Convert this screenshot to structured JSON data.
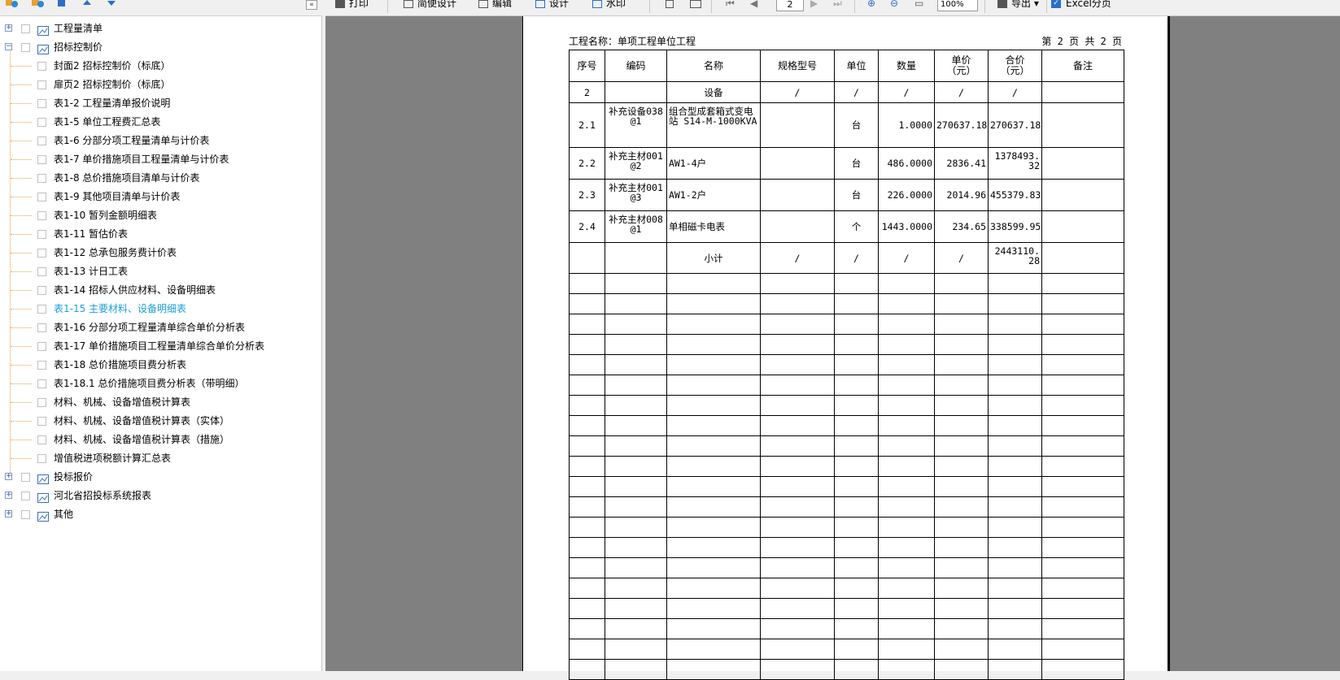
{
  "tree": {
    "nodes": [
      {
        "label": "工程量清单",
        "expander": "+"
      },
      {
        "label": "招标控制价",
        "expander": "−"
      },
      {
        "label": "封面2 招标控制价（标底）"
      },
      {
        "label": "扉页2 招标控制价（标底）"
      },
      {
        "label": "表1-2 工程量清单报价说明"
      },
      {
        "label": "表1-5 单位工程费汇总表"
      },
      {
        "label": "表1-6 分部分项工程量清单与计价表"
      },
      {
        "label": "表1-7 单价措施项目工程量清单与计价表"
      },
      {
        "label": "表1-8 总价措施项目清单与计价表"
      },
      {
        "label": "表1-9 其他项目清单与计价表"
      },
      {
        "label": "表1-10 暂列金额明细表"
      },
      {
        "label": "表1-11 暂估价表"
      },
      {
        "label": "表1-12 总承包服务费计价表"
      },
      {
        "label": "表1-13 计日工表"
      },
      {
        "label": "表1-14 招标人供应材料、设备明细表"
      },
      {
        "label": "表1-15 主要材料、设备明细表"
      },
      {
        "label": "表1-16 分部分项工程量清单综合单价分析表"
      },
      {
        "label": "表1-17 单价措施项目工程量清单综合单价分析表"
      },
      {
        "label": "表1-18 总价措施项目费分析表"
      },
      {
        "label": "表1-18.1 总价措施项目费分析表（带明细）"
      },
      {
        "label": "材料、机械、设备增值税计算表"
      },
      {
        "label": "材料、机械、设备增值税计算表（实体）"
      },
      {
        "label": "材料、机械、设备增值税计算表（措施）"
      },
      {
        "label": "增值税进项税额计算汇总表"
      },
      {
        "label": "投标报价",
        "expander": "+"
      },
      {
        "label": "河北省招投标系统报表",
        "expander": "+"
      },
      {
        "label": "其他",
        "expander": "+"
      }
    ],
    "selected_color": "#1aa0d8"
  },
  "toolbar": {
    "print": "打印",
    "quick_design": "简便设计",
    "edit": "编辑",
    "design": "设计",
    "watermark": "水印",
    "page": "2",
    "zoom": "100%",
    "export": "导出",
    "excel_split": "Excel分页"
  },
  "report": {
    "project": "工程名称：单项工程单位工程",
    "page_info": "第 2 页  共 2 页",
    "headers": [
      "序号",
      "编码",
      "名称",
      "规格型号",
      "单位",
      "数量",
      "单价\n（元）",
      "合价\n（元）",
      "备注"
    ],
    "rows": [
      [
        "2",
        "",
        "设备",
        "/",
        "/",
        "/",
        "/",
        "/",
        ""
      ],
      [
        "2.1",
        "补充设备038@1",
        "组合型成套箱式变电站 S14-M-1000KVA",
        "",
        "台",
        "1.0000",
        "270637.18",
        "270637.18",
        ""
      ],
      [
        "2.2",
        "补充主材001@2",
        "AW1-4户",
        "",
        "台",
        "486.0000",
        "2836.41",
        "1378493.32",
        ""
      ],
      [
        "2.3",
        "补充主材001@3",
        "AW1-2户",
        "",
        "台",
        "226.0000",
        "2014.96",
        "455379.83",
        ""
      ],
      [
        "2.4",
        "补充主材008@1",
        "单相磁卡电表",
        "",
        "个",
        "1443.0000",
        "234.65",
        "338599.95",
        ""
      ],
      [
        "",
        "",
        "小计",
        "/",
        "/",
        "/",
        "/",
        "2443110.28",
        ""
      ]
    ]
  }
}
